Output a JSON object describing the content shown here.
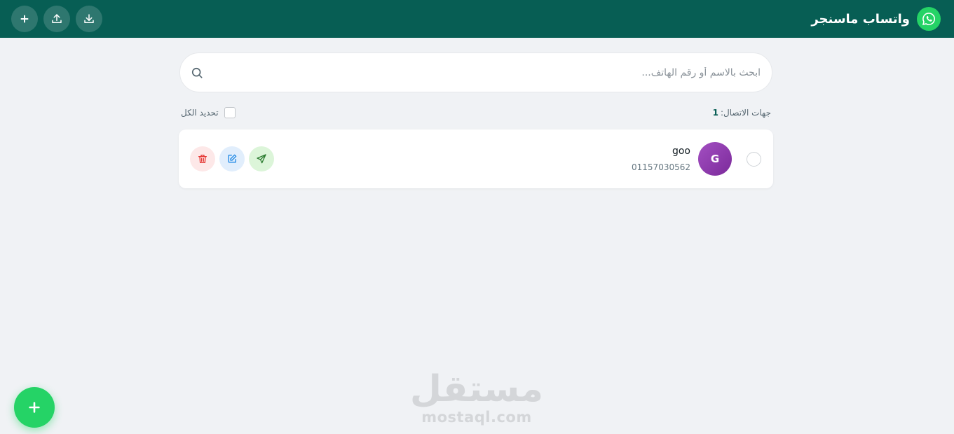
{
  "header": {
    "title": "واتساب ماسنجر",
    "logo_icon": "whatsapp-icon",
    "actions": [
      {
        "icon": "plus-icon",
        "label": "add"
      },
      {
        "icon": "upload-icon",
        "label": "upload"
      },
      {
        "icon": "download-icon",
        "label": "download"
      }
    ]
  },
  "search": {
    "placeholder": "ابحث بالاسم أو رقم الهاتف...",
    "value": ""
  },
  "contacts_meta": {
    "count_label": "جهات الاتصال:",
    "count_value": "1",
    "select_all_label": "تحديد الكل"
  },
  "contacts": [
    {
      "name": "goo",
      "phone": "01157030562",
      "initial": "G"
    }
  ],
  "watermark": {
    "arabic": "مستقل",
    "latin": "mostaql.com"
  },
  "colors": {
    "header_bg": "#075e54",
    "accent": "#25d366",
    "page_bg": "#f0f2f5",
    "avatar": "#9b45bb",
    "delete": "#e53935",
    "edit": "#1e88e5",
    "send": "#2e7d32"
  }
}
